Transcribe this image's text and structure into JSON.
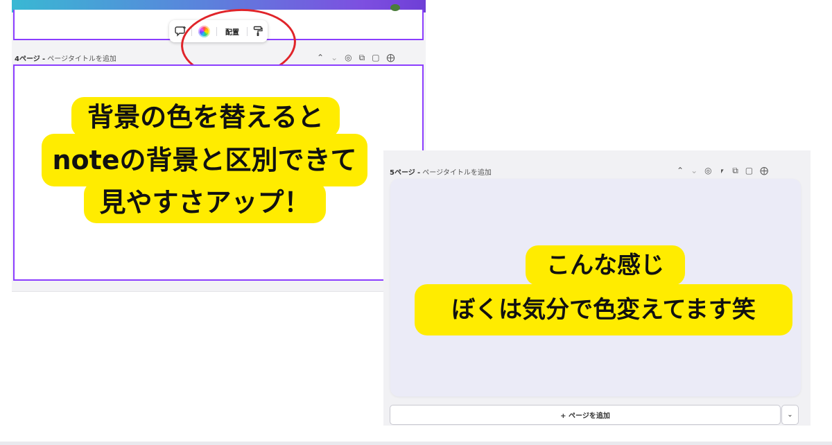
{
  "left_screenshot": {
    "toolbar": {
      "comment_icon": "comment-add-icon",
      "color_icon": "color-wheel-icon",
      "arrange_label": "配置",
      "paint_icon": "paint-roller-icon"
    },
    "page_header": {
      "page_label": "4ページ",
      "separator": "-",
      "title_placeholder": "ページタイトルを追加"
    },
    "header_icons": [
      "chevron-up-icon",
      "chevron-down-icon",
      "eye-icon",
      "duplicate-icon",
      "trash-icon",
      "add-page-icon"
    ],
    "annotation_color": "#e0242a"
  },
  "right_screenshot": {
    "page_header": {
      "page_label": "5ページ",
      "separator": "-",
      "title_placeholder": "ページタイトルを追加"
    },
    "header_icons": [
      "chevron-up-icon",
      "chevron-down-icon",
      "eye-icon",
      "lock-icon",
      "duplicate-icon",
      "trash-icon",
      "add-page-icon"
    ],
    "add_page_button": "+ ページを追加",
    "canvas_background": "#ebebf7"
  },
  "captions": {
    "main": {
      "line1": "背景の色を替えると",
      "line2": "noteの背景と区別できて",
      "line3": "見やすさアップ！"
    },
    "sub": {
      "line1": "こんな感じ",
      "line2": "ぼくは気分で色変えてます笑"
    },
    "highlight_color": "#ffec00"
  }
}
